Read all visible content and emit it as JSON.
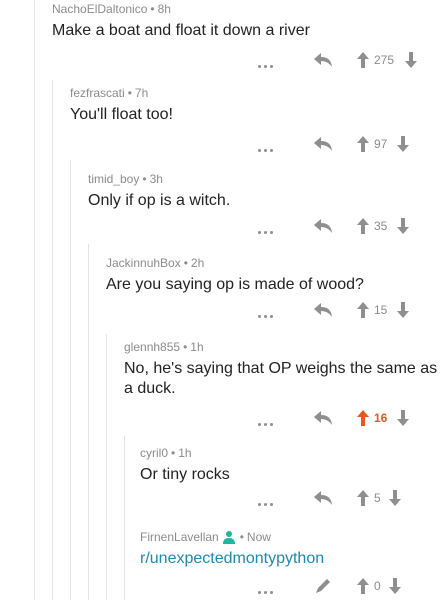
{
  "comments": [
    {
      "user": "NachoElDaltonico",
      "age": "8h",
      "body": "Make a boat and float it down a river",
      "score": "275",
      "upvoted": false
    },
    {
      "user": "fezfrascati",
      "age": "7h",
      "body": "You'll float too!",
      "score": "97",
      "upvoted": false
    },
    {
      "user": "timid_boy",
      "age": "3h",
      "body": "Only if op is a witch.",
      "score": "35",
      "upvoted": false
    },
    {
      "user": "JackinnuhBox",
      "age": "2h",
      "body": "Are you saying op is made of wood?",
      "score": "15",
      "upvoted": false
    },
    {
      "user": "glennh855",
      "age": "1h",
      "body": "No, he's saying that OP weighs the same as a duck.",
      "score": "16",
      "upvoted": true
    },
    {
      "user": "cyril0",
      "age": "1h",
      "body": "Or tiny rocks",
      "score": "5",
      "upvoted": false
    },
    {
      "user": "FirnenLavellan",
      "age": "Now",
      "body": "r/unexpectedmontypython",
      "score": "0",
      "upvoted": false
    }
  ],
  "separator": "•",
  "colors": {
    "upvote_active": "#e8581d",
    "link": "#1a8bb3",
    "icon": "#8f8f8f",
    "thread_line": "#e4e4e4",
    "user_badge": "#1fb59e"
  }
}
